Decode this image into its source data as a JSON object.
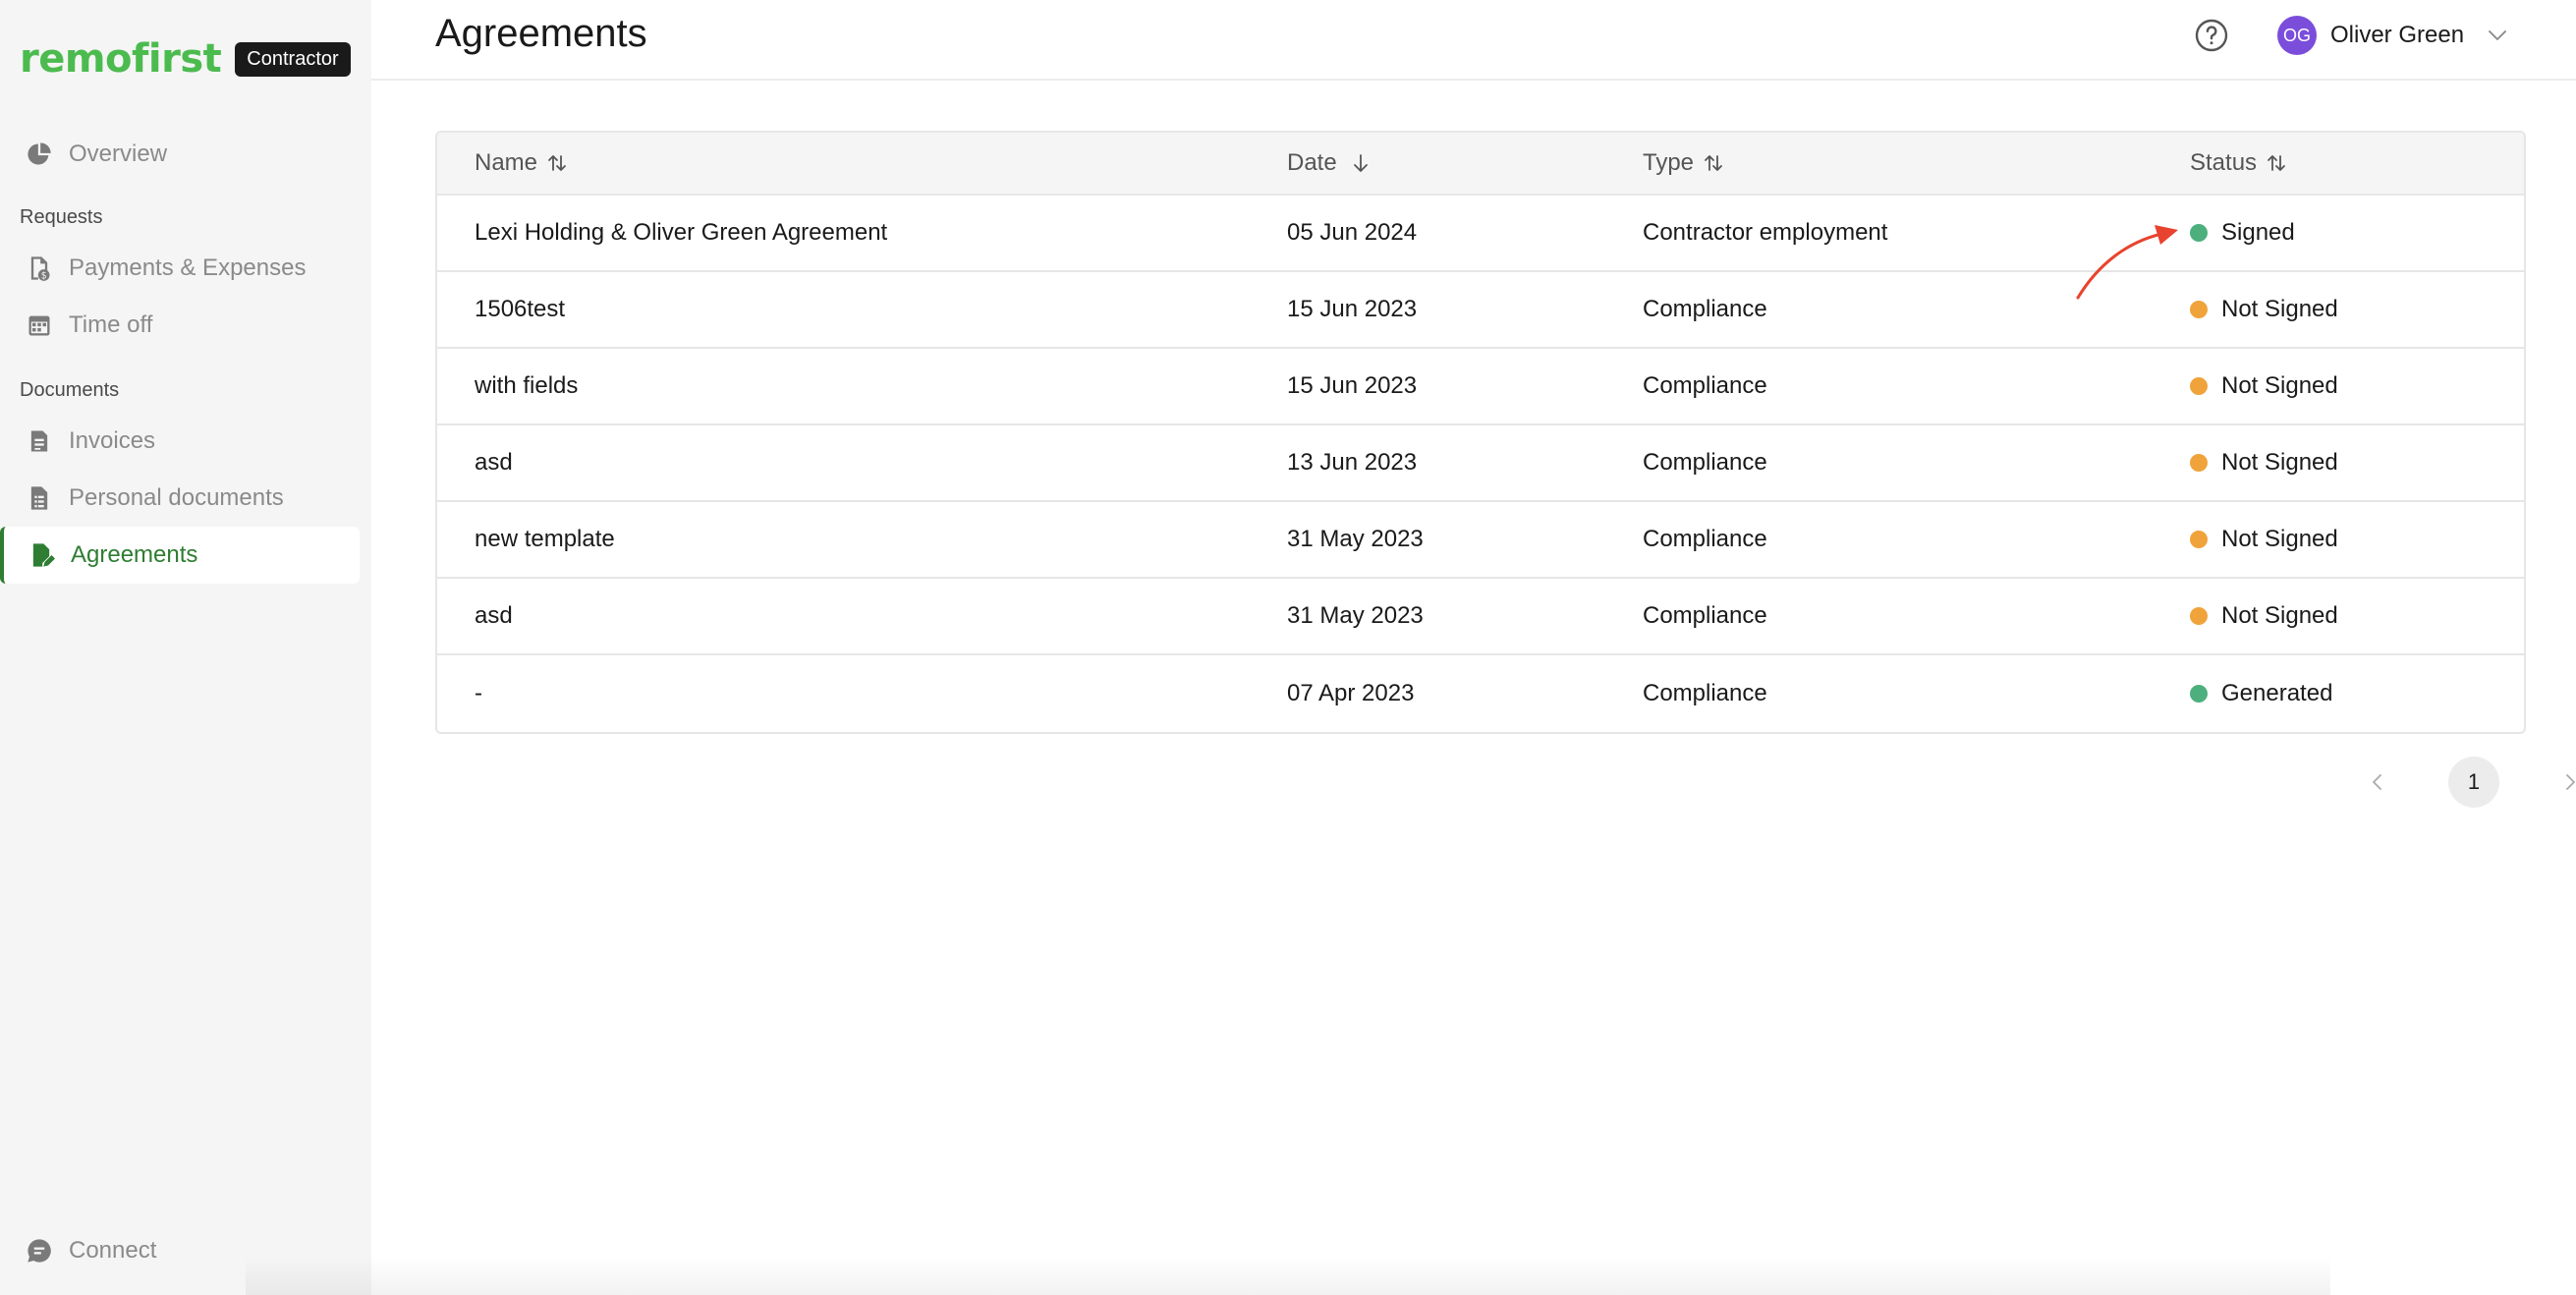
{
  "brand": {
    "logo": "remofirst",
    "badge": "Contractor",
    "accent": "#4cbb4f"
  },
  "sidebar": {
    "overview": "Overview",
    "requests_label": "Requests",
    "payments": "Payments & Expenses",
    "time_off": "Time off",
    "documents_label": "Documents",
    "invoices": "Invoices",
    "personal_documents": "Personal documents",
    "agreements": "Agreements",
    "connect": "Connect"
  },
  "header": {
    "title": "Agreements",
    "user_initials": "OG",
    "user_name": "Oliver Green"
  },
  "table": {
    "columns": {
      "name": "Name",
      "date": "Date",
      "type": "Type",
      "status": "Status"
    },
    "rows": [
      {
        "name": "Lexi Holding & Oliver Green Agreement",
        "date": "05 Jun 2024",
        "type": "Contractor employment",
        "status": "Signed",
        "status_color": "#4caf7d"
      },
      {
        "name": "1506test",
        "date": "15 Jun 2023",
        "type": "Compliance",
        "status": "Not Signed",
        "status_color": "#f0a33a"
      },
      {
        "name": "with fields",
        "date": "15 Jun 2023",
        "type": "Compliance",
        "status": "Not Signed",
        "status_color": "#f0a33a"
      },
      {
        "name": "asd",
        "date": "13 Jun 2023",
        "type": "Compliance",
        "status": "Not Signed",
        "status_color": "#f0a33a"
      },
      {
        "name": "new template",
        "date": "31 May 2023",
        "type": "Compliance",
        "status": "Not Signed",
        "status_color": "#f0a33a"
      },
      {
        "name": "asd",
        "date": "31 May 2023",
        "type": "Compliance",
        "status": "Not Signed",
        "status_color": "#f0a33a"
      },
      {
        "name": "-",
        "date": "07 Apr 2023",
        "type": "Compliance",
        "status": "Generated",
        "status_color": "#4caf7d"
      }
    ]
  },
  "pagination": {
    "current_page": "1"
  }
}
